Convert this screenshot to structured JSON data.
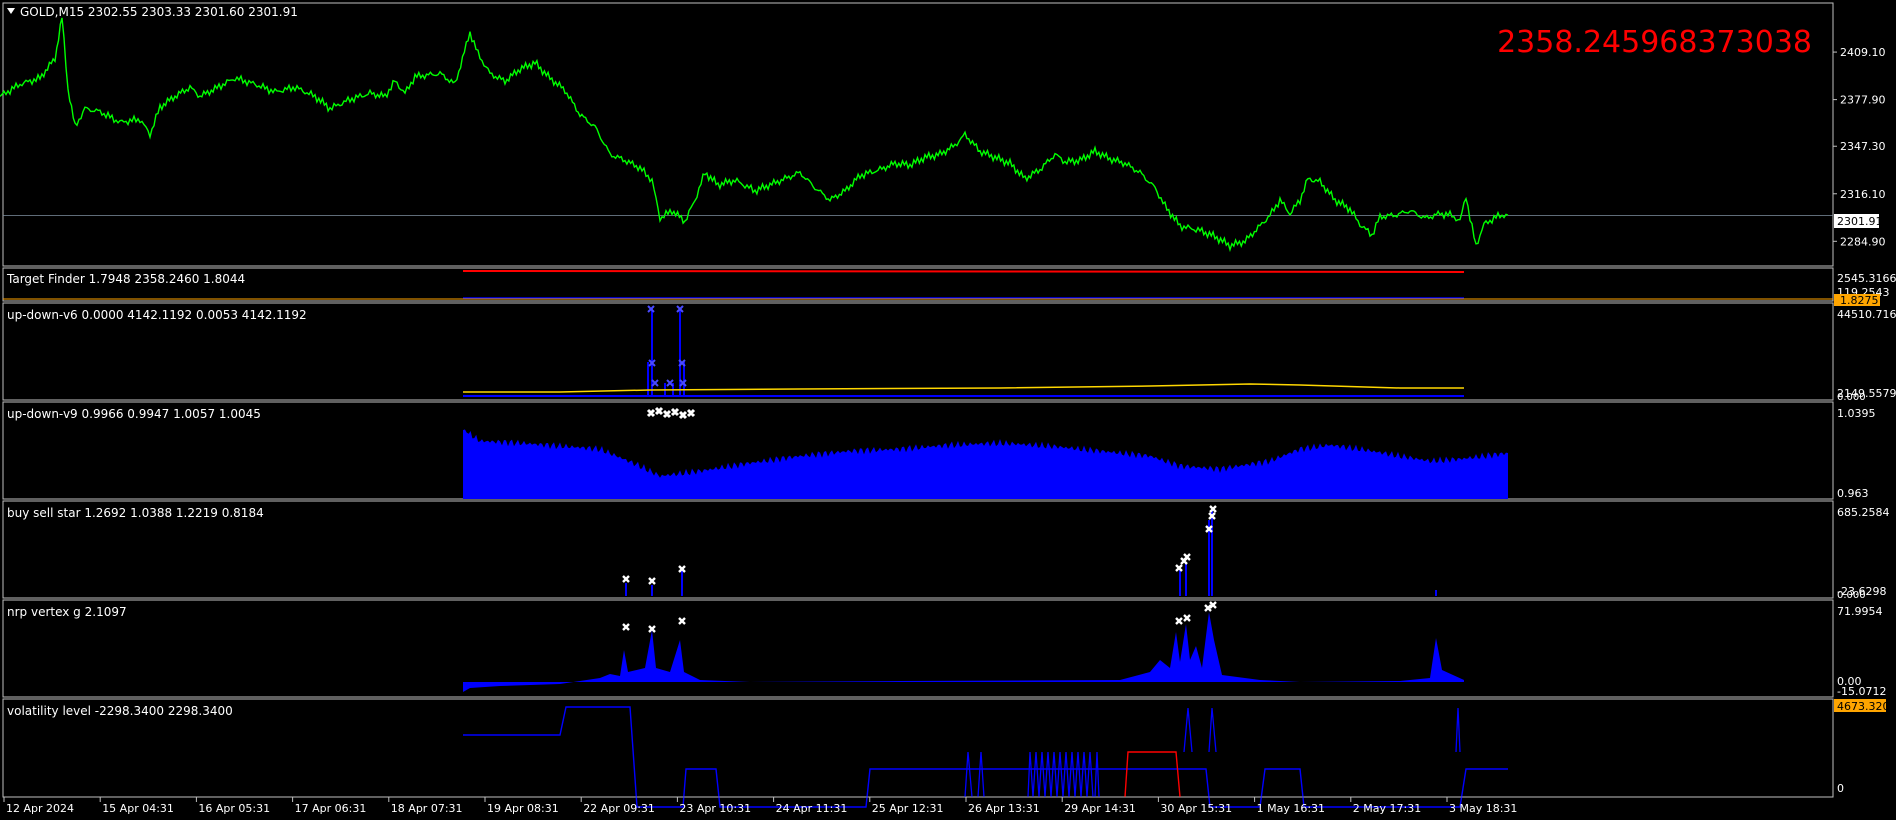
{
  "colors": {
    "background": "#000000",
    "border": "#c0c0c0",
    "price_line": "#00ff00",
    "blue": "#0000ff",
    "yellow": "#ffd700",
    "red": "#ff0000",
    "orange_badge": "#ffa500",
    "white": "#ffffff"
  },
  "main": {
    "title": "GOLD,M15  2302.55 2303.33 2301.60 2301.91",
    "overlay_value": "2358.245968373038",
    "y_ticks": [
      "2409.10",
      "2377.90",
      "2347.30",
      "2316.10",
      "2284.90"
    ],
    "current_price_label": "2301.91",
    "current_price": 2301.91,
    "y_range": [
      2270,
      2440
    ]
  },
  "panels": [
    {
      "title": "Target Finder 1.7948 2358.2460 1.8044",
      "scale": [
        "2545.3166",
        "119.2543"
      ],
      "badge": "1.8275"
    },
    {
      "title": "up-down-v6 0.0000 4142.1192 0.0053 4142.1192",
      "scale": [
        "44510.716",
        "2149.5579",
        "0.000"
      ]
    },
    {
      "title": "up-down-v9 0.9966 0.9947 1.0057 1.0045",
      "scale": [
        "1.0395",
        "0.963"
      ]
    },
    {
      "title": "buy sell star 1.2692 1.0388 1.2219 0.8184",
      "scale": [
        "685.2584",
        "-23.6298",
        "0.000"
      ]
    },
    {
      "title": "nrp vertex g 2.1097",
      "scale": [
        "71.9954",
        "0.00",
        "-15.0712"
      ]
    },
    {
      "title": "volatility level -2298.3400 2298.3400",
      "scale": [
        "0"
      ],
      "badge": "4673.3203"
    }
  ],
  "x_axis": [
    "12 Apr 2024",
    "15 Apr 04:31",
    "16 Apr 05:31",
    "17 Apr 06:31",
    "18 Apr 07:31",
    "19 Apr 08:31",
    "22 Apr 09:31",
    "23 Apr 10:31",
    "24 Apr 11:31",
    "25 Apr 12:31",
    "26 Apr 13:31",
    "29 Apr 14:31",
    "30 Apr 15:31",
    "1 May 16:31",
    "2 May 17:31",
    "3 May 18:31"
  ],
  "price_series": [
    [
      0,
      2380
    ],
    [
      20,
      2388
    ],
    [
      40,
      2392
    ],
    [
      55,
      2405
    ],
    [
      62,
      2432
    ],
    [
      68,
      2385
    ],
    [
      75,
      2360
    ],
    [
      85,
      2372
    ],
    [
      100,
      2370
    ],
    [
      120,
      2363
    ],
    [
      140,
      2365
    ],
    [
      150,
      2355
    ],
    [
      160,
      2373
    ],
    [
      175,
      2380
    ],
    [
      190,
      2386
    ],
    [
      200,
      2380
    ],
    [
      215,
      2385
    ],
    [
      235,
      2392
    ],
    [
      255,
      2388
    ],
    [
      275,
      2383
    ],
    [
      295,
      2386
    ],
    [
      315,
      2380
    ],
    [
      330,
      2372
    ],
    [
      350,
      2378
    ],
    [
      370,
      2382
    ],
    [
      385,
      2380
    ],
    [
      395,
      2390
    ],
    [
      405,
      2382
    ],
    [
      415,
      2393
    ],
    [
      440,
      2395
    ],
    [
      455,
      2388
    ],
    [
      470,
      2422
    ],
    [
      478,
      2408
    ],
    [
      490,
      2395
    ],
    [
      505,
      2390
    ],
    [
      520,
      2398
    ],
    [
      535,
      2402
    ],
    [
      550,
      2392
    ],
    [
      565,
      2384
    ],
    [
      580,
      2368
    ],
    [
      595,
      2360
    ],
    [
      610,
      2342
    ],
    [
      625,
      2338
    ],
    [
      640,
      2333
    ],
    [
      652,
      2325
    ],
    [
      660,
      2300
    ],
    [
      672,
      2305
    ],
    [
      685,
      2298
    ],
    [
      695,
      2312
    ],
    [
      705,
      2330
    ],
    [
      718,
      2322
    ],
    [
      735,
      2325
    ],
    [
      755,
      2318
    ],
    [
      770,
      2322
    ],
    [
      785,
      2326
    ],
    [
      800,
      2330
    ],
    [
      815,
      2320
    ],
    [
      830,
      2312
    ],
    [
      845,
      2318
    ],
    [
      860,
      2328
    ],
    [
      880,
      2332
    ],
    [
      895,
      2336
    ],
    [
      910,
      2335
    ],
    [
      925,
      2340
    ],
    [
      940,
      2342
    ],
    [
      955,
      2348
    ],
    [
      965,
      2355
    ],
    [
      980,
      2344
    ],
    [
      995,
      2340
    ],
    [
      1010,
      2336
    ],
    [
      1025,
      2326
    ],
    [
      1040,
      2332
    ],
    [
      1055,
      2342
    ],
    [
      1065,
      2337
    ],
    [
      1080,
      2338
    ],
    [
      1095,
      2344
    ],
    [
      1110,
      2339
    ],
    [
      1125,
      2336
    ],
    [
      1140,
      2330
    ],
    [
      1155,
      2320
    ],
    [
      1165,
      2308
    ],
    [
      1180,
      2295
    ],
    [
      1200,
      2292
    ],
    [
      1215,
      2288
    ],
    [
      1230,
      2282
    ],
    [
      1245,
      2285
    ],
    [
      1260,
      2295
    ],
    [
      1270,
      2302
    ],
    [
      1280,
      2312
    ],
    [
      1290,
      2303
    ],
    [
      1300,
      2312
    ],
    [
      1308,
      2326
    ],
    [
      1320,
      2324
    ],
    [
      1335,
      2312
    ],
    [
      1350,
      2306
    ],
    [
      1360,
      2296
    ],
    [
      1372,
      2289
    ],
    [
      1380,
      2301
    ],
    [
      1395,
      2302
    ],
    [
      1410,
      2305
    ],
    [
      1425,
      2300
    ],
    [
      1440,
      2303
    ],
    [
      1452,
      2302
    ],
    [
      1460,
      2298
    ],
    [
      1466,
      2315
    ],
    [
      1470,
      2300
    ],
    [
      1476,
      2282
    ],
    [
      1484,
      2296
    ],
    [
      1494,
      2300
    ],
    [
      1500,
      2302
    ],
    [
      1508,
      2302
    ]
  ],
  "volatility_steps": [
    [
      463,
      28
    ],
    [
      560,
      28
    ],
    [
      566,
      0
    ],
    [
      630,
      0
    ],
    [
      637,
      100
    ],
    [
      683,
      100
    ],
    [
      686,
      62
    ],
    [
      716,
      62
    ],
    [
      720,
      100
    ],
    [
      866,
      100
    ],
    [
      870,
      62
    ],
    [
      1206,
      62
    ],
    [
      1210,
      100
    ],
    [
      1260,
      100
    ],
    [
      1265,
      62
    ],
    [
      1300,
      62
    ],
    [
      1304,
      100
    ],
    [
      1460,
      100
    ],
    [
      1466,
      62
    ],
    [
      1508,
      62
    ]
  ],
  "up_down_v9_series": [
    [
      463,
      72
    ],
    [
      480,
      60
    ],
    [
      520,
      58
    ],
    [
      560,
      55
    ],
    [
      600,
      52
    ],
    [
      640,
      35
    ],
    [
      660,
      25
    ],
    [
      700,
      30
    ],
    [
      750,
      38
    ],
    [
      800,
      45
    ],
    [
      850,
      50
    ],
    [
      900,
      52
    ],
    [
      950,
      56
    ],
    [
      1000,
      58
    ],
    [
      1050,
      55
    ],
    [
      1100,
      50
    ],
    [
      1150,
      45
    ],
    [
      1180,
      35
    ],
    [
      1220,
      32
    ],
    [
      1270,
      40
    ],
    [
      1300,
      52
    ],
    [
      1330,
      56
    ],
    [
      1360,
      52
    ],
    [
      1400,
      45
    ],
    [
      1430,
      40
    ],
    [
      1460,
      42
    ],
    [
      1508,
      48
    ]
  ]
}
